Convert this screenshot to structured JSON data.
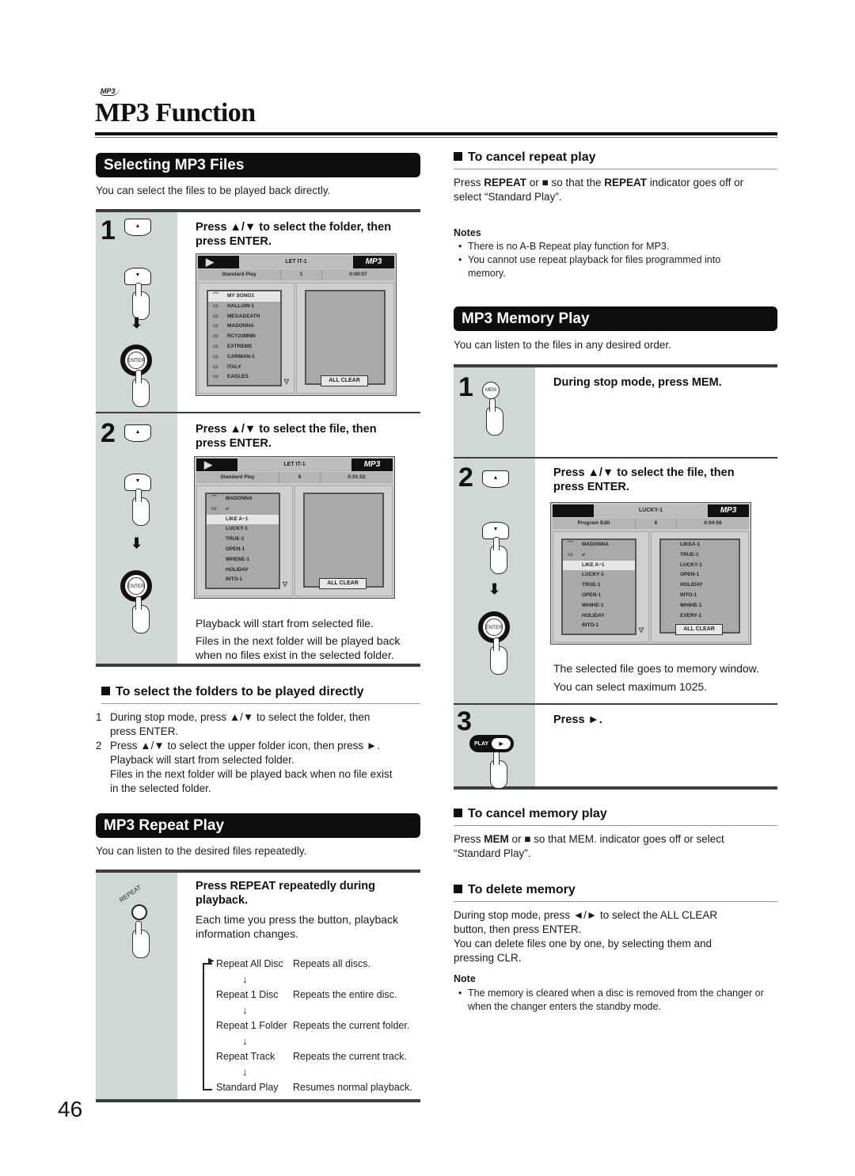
{
  "header": {
    "logo_text": "MP3",
    "title": "MP3 Function"
  },
  "page_number": "46",
  "selecting": {
    "banner": "Selecting MP3 Files",
    "intro": "You can select the files to be played back directly.",
    "steps": [
      {
        "num": "1",
        "instruction_line1": "Press ▲/▼ to select the folder, then",
        "instruction_line2": "press ENTER.",
        "osd": {
          "play_icon": "▶",
          "title": "LET IT-1",
          "logo": "MP3",
          "mode": "Standard Play",
          "number": "1",
          "time": "0:00:07",
          "items": [
            {
              "icon": "up-folder",
              "label": "MY SONG1",
              "selected": true
            },
            {
              "icon": "folder",
              "label": "HALLOW-1"
            },
            {
              "icon": "folder",
              "label": "MEGADEATH"
            },
            {
              "icon": "folder",
              "label": "MADONNA"
            },
            {
              "icon": "folder",
              "label": "RCY23MNN"
            },
            {
              "icon": "folder",
              "label": "EXTREME"
            },
            {
              "icon": "folder",
              "label": "CARMAN-1"
            },
            {
              "icon": "folder",
              "label": "ITALY"
            },
            {
              "icon": "folder",
              "label": "EAGLES"
            }
          ],
          "memory_items": [],
          "clear_button": "ALL CLEAR"
        }
      },
      {
        "num": "2",
        "instruction_line1": "Press ▲/▼ to select the file, then",
        "instruction_line2": "press ENTER.",
        "osd": {
          "play_icon": "▶",
          "title": "LET IT-1",
          "logo": "MP3",
          "mode": "Standard Play",
          "number": "6",
          "time": "0:01:52",
          "items": [
            {
              "icon": "up-folder",
              "label": "MADONNA"
            },
            {
              "icon": "folder",
              "label": "⤶"
            },
            {
              "icon": "",
              "label": "LIKE A~1",
              "selected": true
            },
            {
              "icon": "",
              "label": "LUCKY-1"
            },
            {
              "icon": "",
              "label": "TRUE-1"
            },
            {
              "icon": "",
              "label": "OPEN-1"
            },
            {
              "icon": "",
              "label": "WHENE-1"
            },
            {
              "icon": "",
              "label": "HOLIDAY"
            },
            {
              "icon": "",
              "label": "INTO-1"
            }
          ],
          "memory_items": [],
          "clear_button": "ALL CLEAR"
        },
        "note1": "Playback will start from selected file.",
        "note2_line1": "Files in the next folder will be played back",
        "note2_line2": "when no files exist in the selected folder."
      }
    ],
    "folders": {
      "heading": "To select the folders to be played directly",
      "items": [
        {
          "n": "1",
          "lines": [
            "During stop mode, press ▲/▼ to select the folder, then",
            "press ENTER."
          ]
        },
        {
          "n": "2",
          "lines": [
            "Press ▲/▼ to select the upper folder icon, then press ►.",
            "Playback will start from selected folder.",
            "Files in the next folder will be played back when no file exist",
            "in the selected folder."
          ]
        }
      ]
    }
  },
  "repeat": {
    "banner": "MP3 Repeat Play",
    "intro": "You can listen to the desired files repeatedly.",
    "button_label": "REPEAT",
    "instruction_line1": "Press REPEAT repeatedly during",
    "instruction_line2": "playback.",
    "desc_line1": "Each time you press the button, playback",
    "desc_line2": "information changes.",
    "cycle": [
      {
        "mode": "Repeat All Disc",
        "desc": "Repeats all discs."
      },
      {
        "mode": "Repeat 1 Disc",
        "desc": "Repeats the entire disc."
      },
      {
        "mode": "Repeat 1 Folder",
        "desc": "Repeats the current folder."
      },
      {
        "mode": "Repeat Track",
        "desc": "Repeats the current track."
      },
      {
        "mode": "Standard Play",
        "desc": "Resumes normal playback."
      }
    ]
  },
  "cancel_repeat": {
    "heading": "To cancel repeat play",
    "text_line1": "Press REPEAT or ■ so that the REPEAT indicator goes off or",
    "text_line2": "select “Standard Play”.",
    "notes_heading": "Notes",
    "notes": [
      "There is no A-B Repeat play function for MP3.",
      "You cannot use repeat playback for files programmed into memory."
    ]
  },
  "memory": {
    "banner": "MP3 Memory Play",
    "intro": "You can listen to the files in any desired order.",
    "step1": {
      "num": "1",
      "button": "MEM",
      "instruction": "During stop mode, press MEM."
    },
    "step2": {
      "num": "2",
      "instruction_line1": "Press ▲/▼ to select the file, then",
      "instruction_line2": "press ENTER.",
      "osd": {
        "play_icon": "",
        "title": "LUCKY-1",
        "logo": "MP3",
        "mode": "Program Edit",
        "number": "6",
        "time": "0:04:56",
        "items": [
          {
            "icon": "up-folder",
            "label": "MADONNA"
          },
          {
            "icon": "folder",
            "label": "⤶"
          },
          {
            "icon": "",
            "label": "LIKE A~1",
            "selected": true
          },
          {
            "icon": "",
            "label": "LUCKY-1"
          },
          {
            "icon": "",
            "label": "TRUE-1"
          },
          {
            "icon": "",
            "label": "OPEN-1"
          },
          {
            "icon": "",
            "label": "WHIHE-1"
          },
          {
            "icon": "",
            "label": "HOLIDAY"
          },
          {
            "icon": "",
            "label": "INTO-1"
          }
        ],
        "memory_items": [
          "LIKEA-1",
          "TRUE-1",
          "LUCKY-1",
          "OPEN-1",
          "HOLIDAY",
          "INTO-1",
          "WHIHE-1",
          "EVERY-1"
        ],
        "clear_button": "ALL CLEAR"
      },
      "note1": "The selected file goes to memory window.",
      "note2": "You can select maximum 1025."
    },
    "step3": {
      "num": "3",
      "button": "PLAY",
      "instruction": "Press ►."
    }
  },
  "cancel_memory": {
    "heading": "To cancel memory play",
    "text_line1": "Press MEM or ■ so that MEM. indicator goes off or select",
    "text_line2": "“Standard Play”."
  },
  "delete_memory": {
    "heading": "To delete memory",
    "lines": [
      "During stop mode, press ◄/► to select the ALL CLEAR",
      "button, then press ENTER.",
      "You can delete files one by one, by selecting them and",
      "pressing CLR."
    ],
    "note_heading": "Note",
    "notes": [
      "The memory is cleared when a disc is removed from the changer or when the changer enters the standby mode."
    ]
  }
}
